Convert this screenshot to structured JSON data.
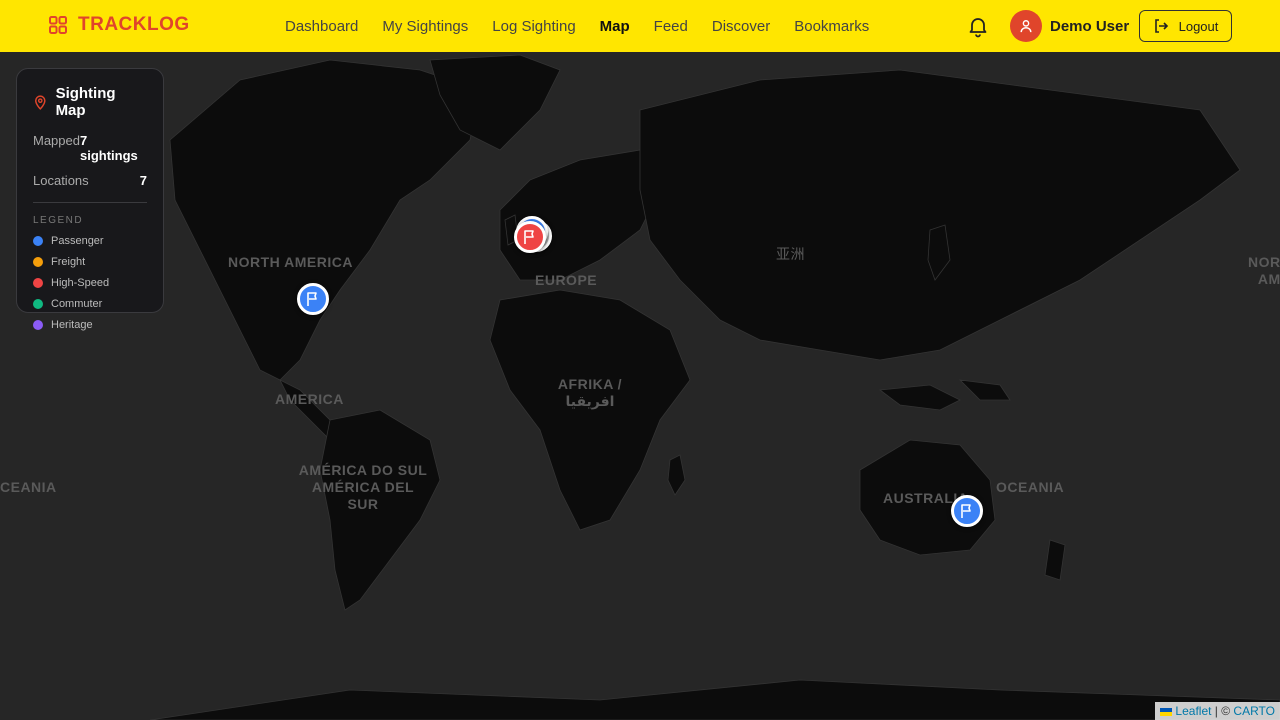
{
  "header": {
    "brand": "TRACKLOG",
    "nav": [
      "Dashboard",
      "My Sightings",
      "Log Sighting",
      "Map",
      "Feed",
      "Discover",
      "Bookmarks"
    ],
    "active_nav": "Map",
    "user_name": "Demo User",
    "logout_label": "Logout"
  },
  "panel": {
    "title": "Sighting Map",
    "mapped_label": "Mapped",
    "mapped_value": "7 sightings",
    "locations_label": "Locations",
    "locations_value": "7",
    "legend_title": "LEGEND",
    "legend": [
      {
        "label": "Passenger",
        "color": "#3b82f6"
      },
      {
        "label": "Freight",
        "color": "#f59e0b"
      },
      {
        "label": "High-Speed",
        "color": "#ef4444"
      },
      {
        "label": "Commuter",
        "color": "#10b981"
      },
      {
        "label": "Heritage",
        "color": "#8b5cf6"
      }
    ]
  },
  "map": {
    "labels": {
      "north_america": "NORTH AMERICA",
      "north_america_right": "NORTH AME",
      "europe": "EUROPE",
      "asia": "亚洲",
      "america": "AMERICA",
      "africa": "AFRIKA / افريقيا",
      "south_america_1": "AMÉRICA DO SUL",
      "south_america_2": "AMÉRICA DEL SUR",
      "australia": "AUSTRALIA",
      "oceania": "OCEANIA",
      "oceania_left": "CEANIA"
    },
    "attribution_leaflet": "Leaflet",
    "attribution_sep": " | © ",
    "attribution_carto": "CARTO"
  },
  "markers": [
    {
      "place": "Eastern USA",
      "type": "Passenger",
      "color": "#3b82f6"
    },
    {
      "place": "Western Europe",
      "type": "Passenger",
      "color": "#3b82f6"
    },
    {
      "place": "Western Europe",
      "type": "High-Speed",
      "color": "#ef4444"
    },
    {
      "place": "Eastern Australia",
      "type": "Passenger",
      "color": "#3b82f6"
    }
  ]
}
